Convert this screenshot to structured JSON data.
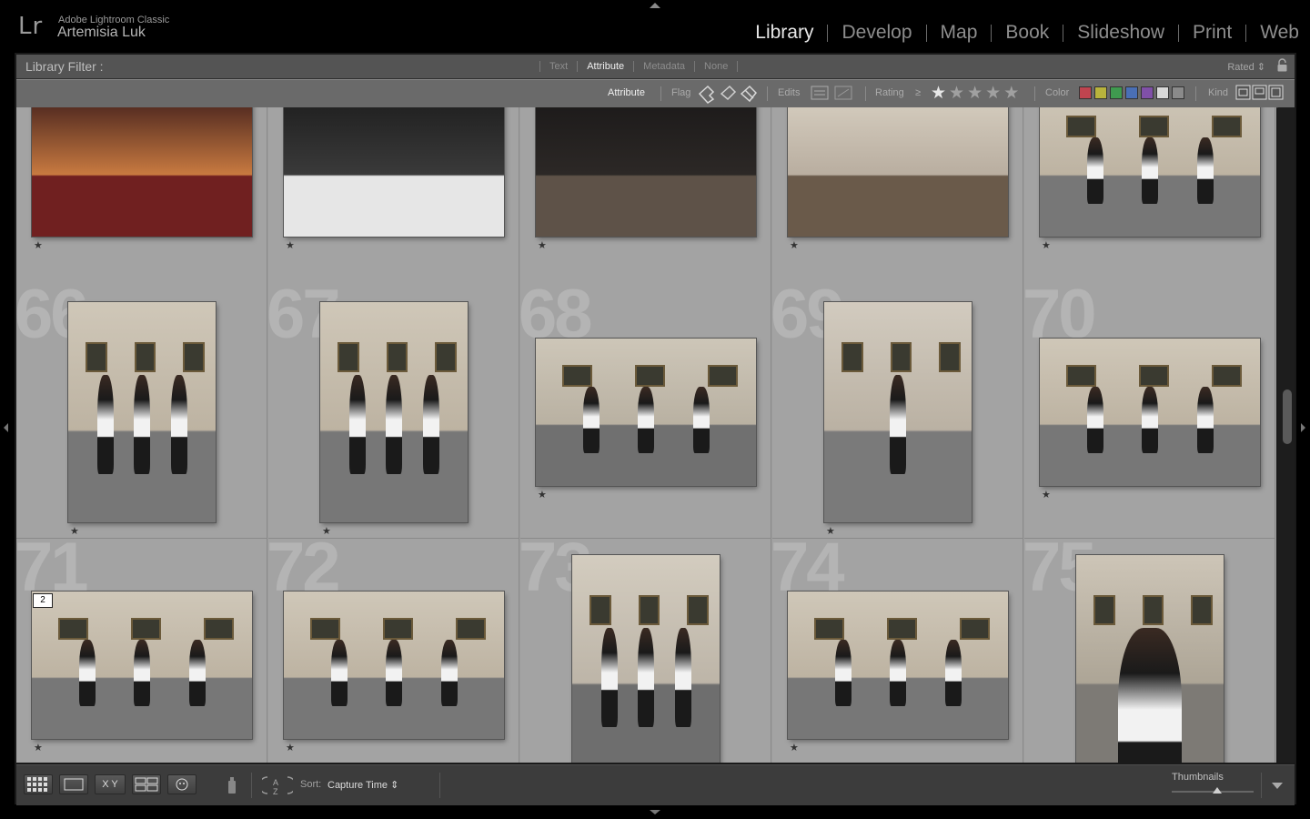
{
  "identity": {
    "logo": "Lr",
    "app_name": "Adobe Lightroom Classic",
    "catalog_user": "Artemisia Luk"
  },
  "modules": [
    "Library",
    "Develop",
    "Map",
    "Book",
    "Slideshow",
    "Print",
    "Web"
  ],
  "active_module": "Library",
  "filter_bar": {
    "label": "Library Filter :",
    "tabs": [
      "Text",
      "Attribute",
      "Metadata",
      "None"
    ],
    "active_tab": "Attribute",
    "preset": "Rated"
  },
  "attribute_bar": {
    "title": "Attribute",
    "flag_label": "Flag",
    "edits_label": "Edits",
    "rating_label": "Rating",
    "rating_op": "≥",
    "color_label": "Color",
    "kind_label": "Kind",
    "colors": [
      "#c0444f",
      "#b8b33c",
      "#3f9a4f",
      "#4a6fb5",
      "#8050a8",
      "#d8d8d8",
      "#8a8a8a"
    ]
  },
  "grid": {
    "rows": [
      {
        "cells": [
          {
            "index": "",
            "orientation": "landscape",
            "rating": "★",
            "scene": "party"
          },
          {
            "index": "",
            "orientation": "landscape",
            "rating": "★",
            "scene": "dj-table"
          },
          {
            "index": "",
            "orientation": "landscape",
            "rating": "★",
            "scene": "mixer"
          },
          {
            "index": "",
            "orientation": "landscape",
            "rating": "★",
            "scene": "gallery-crowd"
          },
          {
            "index": "",
            "orientation": "landscape",
            "rating": "★",
            "scene": "dancers"
          }
        ]
      },
      {
        "cells": [
          {
            "index": "66",
            "orientation": "portrait",
            "rating": "★",
            "scene": "dancers"
          },
          {
            "index": "67",
            "orientation": "portrait",
            "rating": "★",
            "scene": "dancers"
          },
          {
            "index": "68",
            "orientation": "landscape",
            "rating": "★",
            "scene": "floor"
          },
          {
            "index": "69",
            "orientation": "portrait",
            "rating": "★",
            "scene": "solo"
          },
          {
            "index": "70",
            "orientation": "landscape",
            "rating": "★",
            "scene": "dancers"
          }
        ]
      },
      {
        "cells": [
          {
            "index": "71",
            "orientation": "landscape",
            "rating": "★",
            "scene": "dancers",
            "stack": "2"
          },
          {
            "index": "72",
            "orientation": "landscape",
            "rating": "★",
            "scene": "dancers"
          },
          {
            "index": "73",
            "orientation": "portrait",
            "rating": "",
            "scene": "sculpture"
          },
          {
            "index": "74",
            "orientation": "landscape",
            "rating": "★",
            "scene": "dancers"
          },
          {
            "index": "75",
            "orientation": "portrait",
            "rating": "",
            "scene": "closeup"
          }
        ]
      }
    ]
  },
  "toolbar": {
    "sort_label": "Sort:",
    "sort_value": "Capture Time",
    "thumbnails_label": "Thumbnails",
    "thumbnail_size": 0.55,
    "compare_label": "X Y"
  }
}
